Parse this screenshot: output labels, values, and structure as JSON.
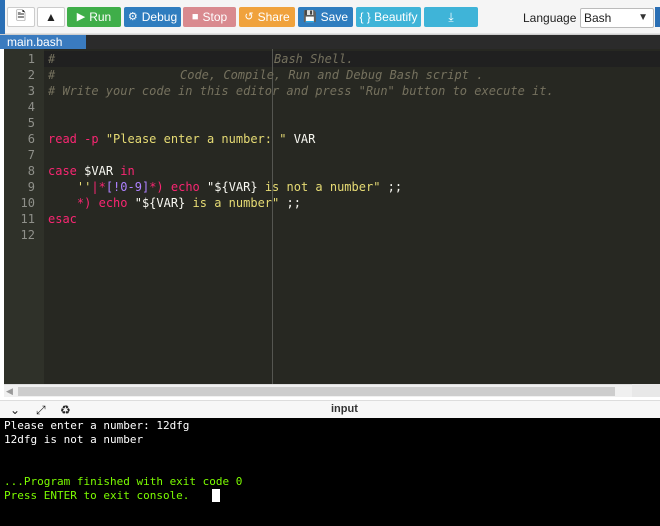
{
  "toolbar": {
    "run_label": "Run",
    "debug_label": "Debug",
    "stop_label": "Stop",
    "share_label": "Share",
    "save_label": "Save",
    "beautify_label": "{ } Beautify",
    "language_label": "Language",
    "language_value": "Bash"
  },
  "tabs": [
    {
      "label": "main.bash"
    }
  ],
  "editor": {
    "line_numbers": [
      "1",
      "2",
      "3",
      "4",
      "5",
      "6",
      "7",
      "8",
      "9",
      "10",
      "11",
      "12"
    ],
    "lines": {
      "l1_hash": "#",
      "l1_text": "Bash Shell.",
      "l2_hash": "#",
      "l2_text": "Code, Compile, Run and Debug Bash script .",
      "l3_text": "# Write your code in this editor and press \"Run\" button to execute it.",
      "l6_cmd": "read",
      "l6_opt": "-p",
      "l6_str": "\"Please enter a number: \"",
      "l6_var": "VAR",
      "l8_case": "case",
      "l8_var": "$VAR",
      "l8_in": "in",
      "l9_q": "''",
      "l9_pipe": "|",
      "l9_star": "*",
      "l9_bracket": "[!0-9]",
      "l9_paren": "*)",
      "l9_echo": "echo",
      "l9_str1": "\"${VAR}",
      "l9_str2": "is not a number\"",
      "l9_end": ";;",
      "l10_pat": "*)",
      "l10_echo": "echo",
      "l10_str1": "\"${VAR}",
      "l10_str2": "is a number\"",
      "l10_end": ";;",
      "l11_esac": "esac"
    }
  },
  "io": {
    "title": "input"
  },
  "console": {
    "lines": [
      "Please enter a number: 12dfg",
      "12dfg is not a number",
      "",
      "",
      "...Program finished with exit code 0",
      "Press ENTER to exit console."
    ]
  }
}
